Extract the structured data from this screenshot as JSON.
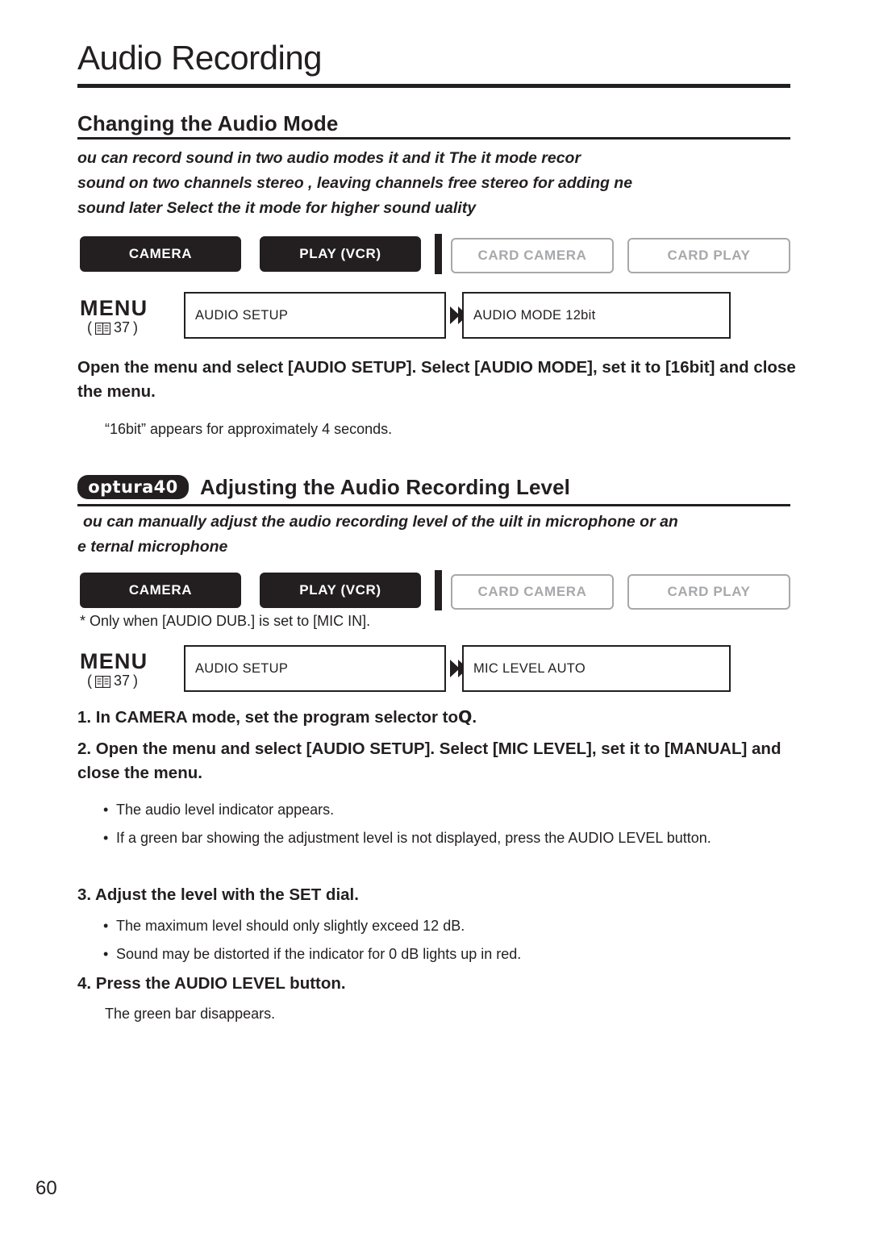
{
  "chapter": {
    "title": "Audio Recording"
  },
  "section1": {
    "title": "Changing the Audio Mode",
    "intro_lines": [
      "ou can record sound in two audio modes        it and        it  The          it mode recor",
      "sound on two channels  stereo     , leaving    channels free  stereo     for adding ne",
      "sound later  Select the        it mode for higher sound   uality"
    ],
    "modes": [
      {
        "label": "CAMERA",
        "state": "on"
      },
      {
        "label": "PLAY (VCR)",
        "state": "on"
      },
      {
        "label": "CARD CAMERA",
        "state": "off"
      },
      {
        "label": "CARD PLAY",
        "state": "off"
      }
    ],
    "menu": {
      "label": "MENU",
      "ref": "( 37)",
      "ref_page": "37",
      "box1": "AUDIO SETUP",
      "box2": "AUDIO MODE   12bit",
      "arrow_icon": "double-chevron-right-icon"
    },
    "instruction": "Open the menu and select [AUDIO SETUP]. Select [AUDIO MODE], set it to [16bit] and close the menu.",
    "note": "“16bit” appears for approximately 4 seconds."
  },
  "section2": {
    "badge": "optura40",
    "title": "Adjusting the Audio Recording Level",
    "intro_lines": [
      "ou can manually adjust the audio recording level of the    uilt in microphone or an",
      "e  ternal microphone"
    ],
    "modes": [
      {
        "label": "CAMERA",
        "state": "on"
      },
      {
        "label": "PLAY (VCR)",
        "state": "on",
        "asterisk": "*"
      },
      {
        "label": "CARD CAMERA",
        "state": "off"
      },
      {
        "label": "CARD PLAY",
        "state": "off"
      }
    ],
    "footnote": "* Only when [AUDIO DUB.] is set to [MIC IN].",
    "menu": {
      "label": "MENU",
      "ref": "( 37)",
      "ref_page": "37",
      "box1": "AUDIO SETUP",
      "box2": "MIC LEVEL   AUTO",
      "arrow_icon": "double-chevron-right-icon"
    },
    "steps": [
      {
        "text": "1. In CAMERA mode, set the program selector to",
        "glyph": "Q",
        "suffix": "."
      },
      {
        "text": "2. Open the menu and select [AUDIO SETUP]. Select [MIC LEVEL], set it to [MANUAL] and close the menu."
      },
      {
        "text": "3. Adjust the level with the SET dial."
      },
      {
        "text": "4. Press the AUDIO LEVEL button."
      }
    ],
    "bullets_step2": [
      "The audio level indicator appears.",
      "If a green bar showing the adjustment level is not displayed, press the AUDIO LEVEL button."
    ],
    "bullets_step3": [
      "The maximum level should only slightly exceed 12 dB.",
      "Sound may be distorted if the indicator for 0 dB lights up in red."
    ],
    "note_step4": "The green bar disappears."
  },
  "footer": {
    "page_number": "60"
  },
  "colors": {
    "ink": "#231f20",
    "muted": "#a6a8ab"
  }
}
